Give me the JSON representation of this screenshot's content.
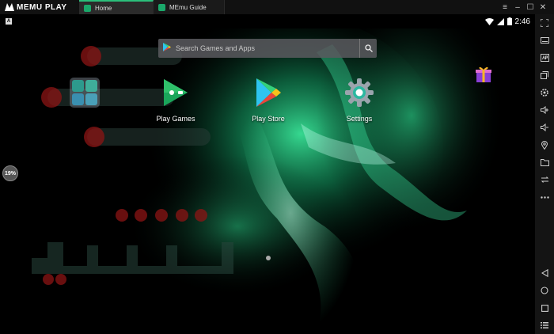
{
  "titlebar": {
    "logo_text": "MEMU PLAY",
    "tabs": [
      {
        "label": "Home",
        "active": true
      },
      {
        "label": "MEmu Guide",
        "active": false
      }
    ],
    "controls": [
      "≡",
      "–",
      "☐",
      "✕"
    ]
  },
  "statusbar": {
    "notification_icon": "A",
    "time": "2:46"
  },
  "search": {
    "placeholder": "Search Games and Apps"
  },
  "apps": [
    {
      "label": "Play Games",
      "icon": "play-games-icon"
    },
    {
      "label": "Play Store",
      "icon": "play-store-icon"
    },
    {
      "label": "Settings",
      "icon": "settings-icon"
    }
  ],
  "progress": {
    "label": "19%",
    "value": 19
  },
  "colors": {
    "accent": "#2bbf7a",
    "aurora": "#1fd68a",
    "watermark_dot": "#8c1414"
  },
  "sidebar_icons": [
    "fullscreen-icon",
    "keyboard-icon",
    "apk-icon",
    "multi-window-icon",
    "gear-icon",
    "volume-up-icon",
    "volume-down-icon",
    "location-icon",
    "folder-icon",
    "rotate-icon",
    "more-icon",
    "back-icon",
    "home-icon",
    "recents-icon",
    "menu-icon"
  ]
}
